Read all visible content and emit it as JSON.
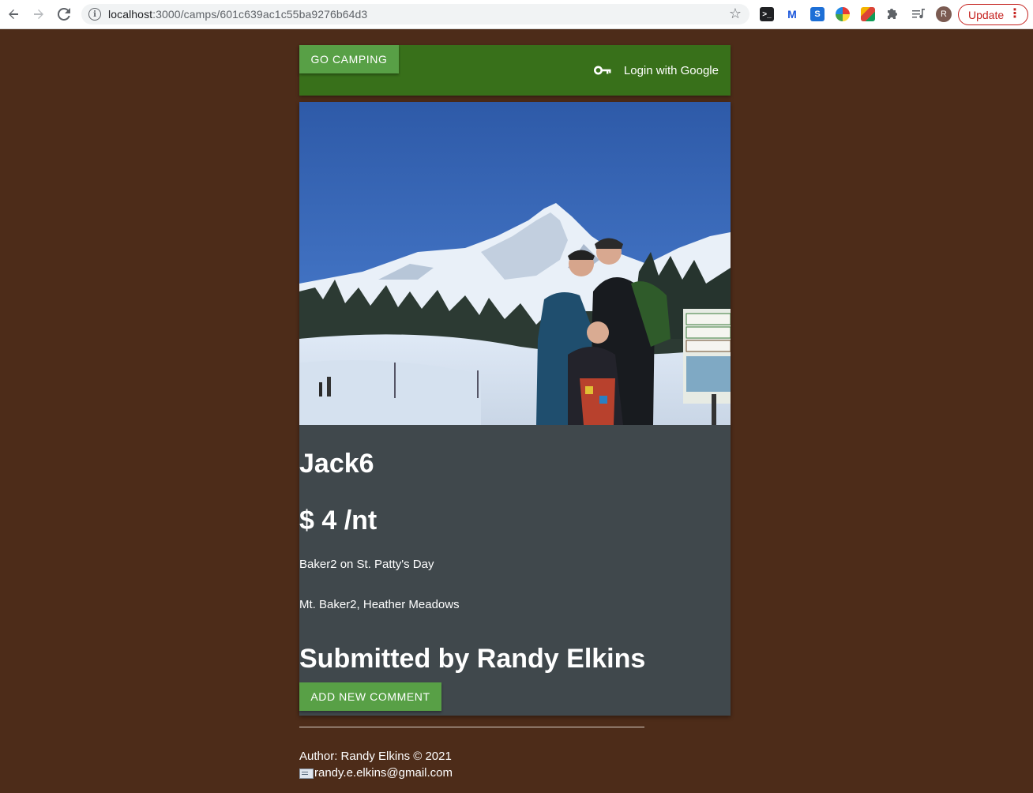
{
  "browser": {
    "url_host": "localhost",
    "url_path": ":3000/camps/601c639ac1c55ba9276b64d3",
    "avatar_letter": "R",
    "update_label": "Update"
  },
  "navbar": {
    "brand_label": "GO CAMPING",
    "login_label": "Login with Google"
  },
  "camp": {
    "name": "Jack6",
    "price": "$ 4 /nt",
    "description": "Baker2 on St. Patty's Day",
    "location": "Mt. Baker2, Heather Meadows",
    "submitted_by": "Submitted by Randy Elkins",
    "add_comment_label": "ADD NEW COMMENT"
  },
  "footer": {
    "author": "Author: Randy Elkins © 2021",
    "email": "randy.e.elkins@gmail.com"
  },
  "colors": {
    "page_background": "#4d2c19",
    "navbar": "#38701a",
    "button": "#58a046",
    "card": "#40484c",
    "update_accent": "#c5221f"
  },
  "icons": {
    "back": "arrow-left-icon",
    "forward": "arrow-right-icon",
    "reload": "reload-icon",
    "site_info": "info-icon",
    "bookmark": "star-icon",
    "login": "key-icon",
    "email": "envelope-icon"
  }
}
